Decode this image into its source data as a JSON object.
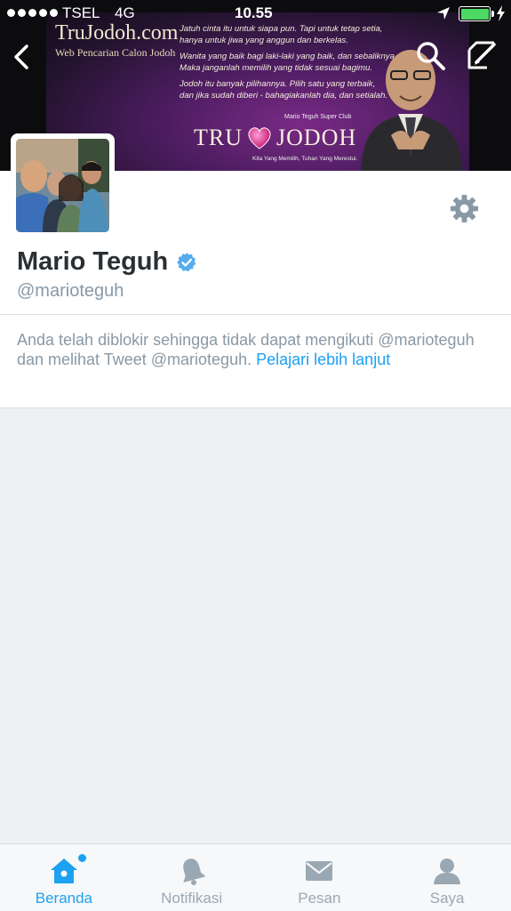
{
  "status_bar": {
    "carrier": "TSEL",
    "network": "4G",
    "time": "10.55",
    "battery_color": "#4cd964"
  },
  "header_banner": {
    "site_title": "TruJodoh.com",
    "site_subtitle": "Web Pencarian Calon Jodoh",
    "quote_lines": [
      "Jatuh cinta itu untuk siapa pun. Tapi untuk tetap setia,",
      "hanya untuk jiwa yang anggun dan berkelas.",
      "",
      "Wanita yang baik bagi laki-laki yang baik, dan sebaliknya.",
      "Maka janganlah memilih yang tidak sesuai bagimu.",
      "",
      "Jodoh itu banyak pilihannya. Pilih satu yang terbaik,",
      "dan jika sudah diberi - bahagiakanlah dia, dan setialah."
    ],
    "club": "Mario Teguh Super Club",
    "brand_left": "TRU",
    "brand_right": "JODOH",
    "tagline": "Kita Yang Memilih, Tuhan Yang Merestui."
  },
  "nav": {
    "back_icon": "chevron-left-icon",
    "search_icon": "search-icon",
    "compose_icon": "compose-icon"
  },
  "profile": {
    "name": "Mario Teguh",
    "handle": "@marioteguh",
    "verified": true,
    "settings_icon": "gear-icon"
  },
  "blocked_notice": {
    "text": "Anda telah diblokir sehingga tidak dapat mengikuti @marioteguh dan melihat Tweet @marioteguh.",
    "link": "Pelajari lebih lanjut"
  },
  "tabbar": {
    "active_color": "#1da1f2",
    "tabs": [
      {
        "label": "Beranda",
        "icon": "home-icon",
        "active": true,
        "has_dot": true
      },
      {
        "label": "Notifikasi",
        "icon": "bell-icon",
        "active": false
      },
      {
        "label": "Pesan",
        "icon": "envelope-icon",
        "active": false
      },
      {
        "label": "Saya",
        "icon": "person-icon",
        "active": false
      }
    ]
  }
}
